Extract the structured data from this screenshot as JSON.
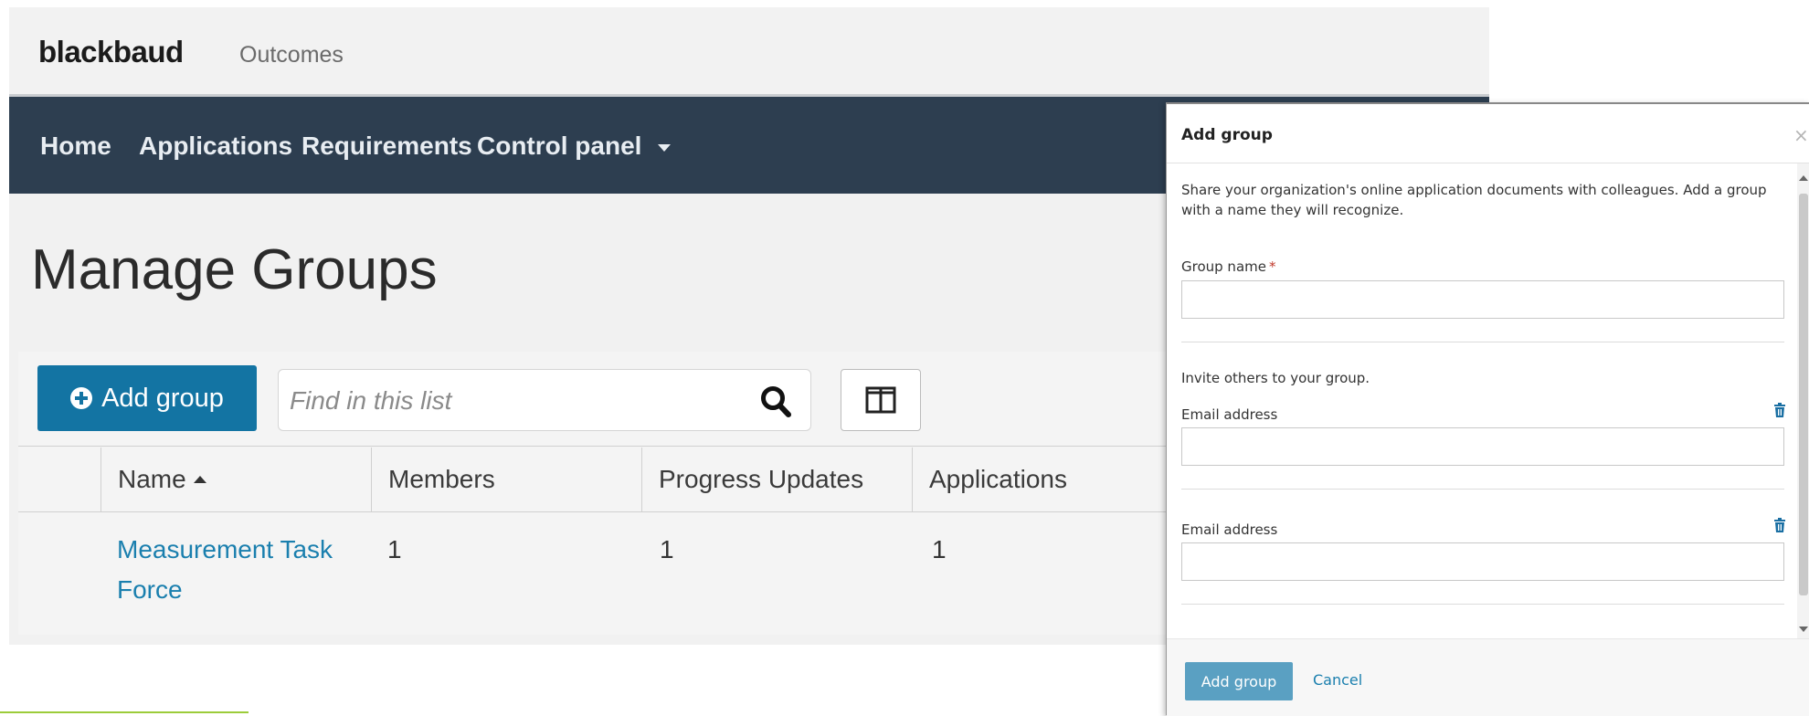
{
  "header": {
    "brand": "blackbaud",
    "product": "Outcomes"
  },
  "nav": {
    "items": [
      {
        "label": "Home"
      },
      {
        "label": "Applications"
      },
      {
        "label": "Requirements"
      },
      {
        "label": "Control panel"
      }
    ]
  },
  "page": {
    "title": "Manage Groups"
  },
  "toolbar": {
    "add_group_label": "Add group",
    "search_placeholder": "Find in this list"
  },
  "table": {
    "columns": [
      "Name",
      "Members",
      "Progress Updates",
      "Applications"
    ],
    "sort_column": "Name",
    "rows": [
      {
        "name": "Measurement Task Force",
        "members": "1",
        "progress_updates": "1",
        "applications": "1"
      }
    ]
  },
  "modal": {
    "title": "Add group",
    "close_glyph": "×",
    "description": "Share your organization's online application documents with colleagues. Add a group with a name they will recognize.",
    "group_name_label": "Group name",
    "required_marker": "*",
    "invite_text": "Invite others to your group.",
    "email_label_1": "Email address",
    "email_label_2": "Email address",
    "submit_label": "Add group",
    "cancel_label": "Cancel"
  },
  "colors": {
    "nav_bg": "#2d3e50",
    "primary_button": "#1374a3",
    "link": "#1a7fae",
    "modal_primary": "#5aa0c2",
    "accent_strip": "#9ccc3a"
  }
}
